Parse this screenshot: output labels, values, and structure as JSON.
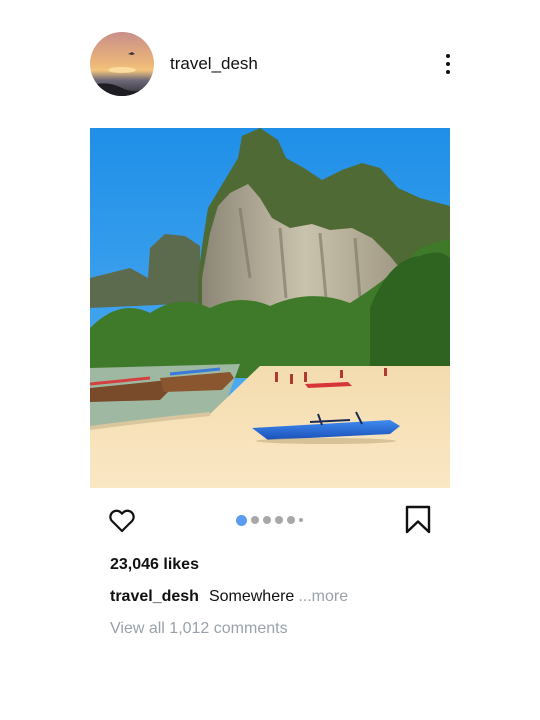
{
  "post": {
    "username": "travel_desh",
    "likes": "23,046 likes",
    "caption": {
      "username": "travel_desh",
      "text": "Somewhere",
      "more": "...more"
    },
    "view_comments": "View all 1,012 comments",
    "carousel": {
      "total_indicators": 6,
      "active_index": 0
    }
  },
  "icons": {
    "options": "more-vertical-icon",
    "like": "heart-outline-icon",
    "save": "bookmark-outline-icon"
  },
  "colors": {
    "active_dot": "#5b9cf0",
    "inactive_dot": "#a8a8a8",
    "muted_text": "#9aa1a9",
    "text": "#111111"
  }
}
